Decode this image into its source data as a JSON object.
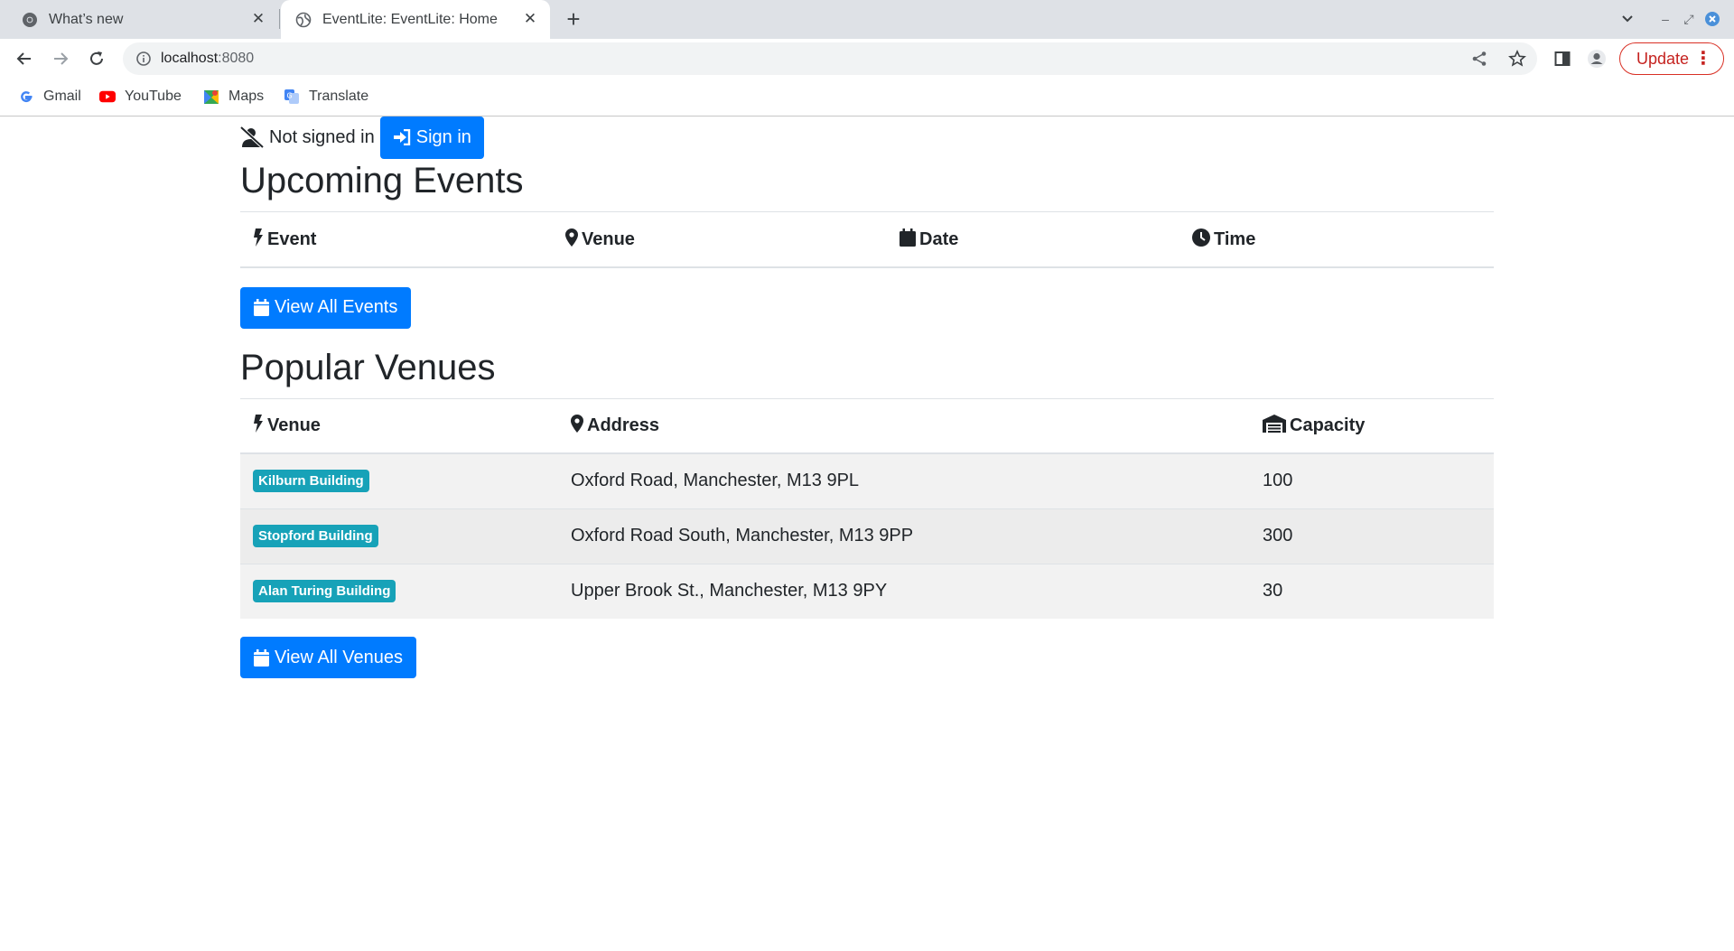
{
  "browser": {
    "tabs": [
      {
        "title": "What’s new",
        "active": false
      },
      {
        "title": "EventLite: EventLite: Home",
        "active": true
      }
    ],
    "url_host": "localhost",
    "url_port": ":8080",
    "update_label": "Update",
    "bookmarks": [
      {
        "label": "Gmail",
        "icon": "gmail-icon"
      },
      {
        "label": "YouTube",
        "icon": "youtube-icon"
      },
      {
        "label": "Maps",
        "icon": "maps-icon"
      },
      {
        "label": "Translate",
        "icon": "translate-icon"
      }
    ]
  },
  "auth": {
    "status": "Not signed in",
    "signin_label": "Sign in"
  },
  "events": {
    "heading": "Upcoming Events",
    "columns": [
      "Event",
      "Venue",
      "Date",
      "Time"
    ],
    "rows": [],
    "view_all_label": "View All Events"
  },
  "venues": {
    "heading": "Popular Venues",
    "columns": [
      "Venue",
      "Address",
      "Capacity"
    ],
    "rows": [
      {
        "name": "Kilburn Building",
        "address": "Oxford Road, Manchester, M13 9PL",
        "capacity": "100"
      },
      {
        "name": "Stopford Building",
        "address": "Oxford Road South, Manchester, M13 9PP",
        "capacity": "300"
      },
      {
        "name": "Alan Turing Building",
        "address": "Upper Brook St., Manchester, M13 9PY",
        "capacity": "30"
      }
    ],
    "view_all_label": "View All Venues"
  },
  "colors": {
    "primary": "#007bff",
    "badge": "#17a2b8",
    "update_red": "#d93025"
  }
}
